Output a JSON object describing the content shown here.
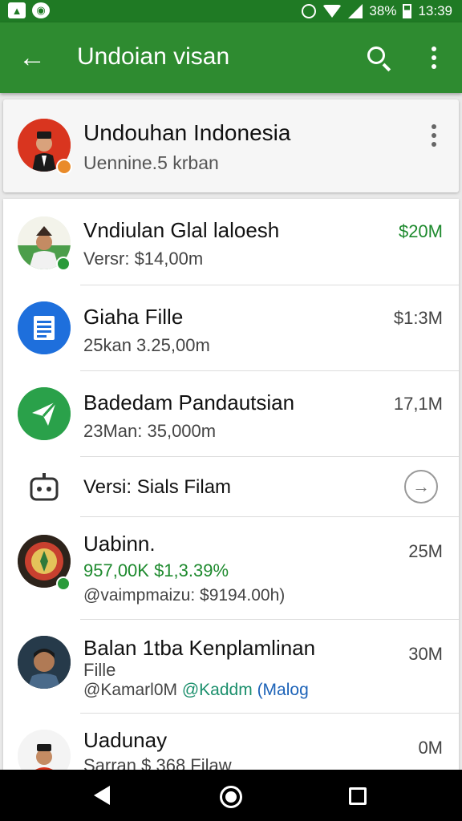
{
  "status_bar": {
    "battery": "38%",
    "time": "13:39",
    "left_icons": [
      "app-notification-icon",
      "whatsapp-icon"
    ],
    "right_icons": [
      "alarm-icon",
      "wifi-icon",
      "signal-icon",
      "battery-icon"
    ]
  },
  "app_bar": {
    "title": "Undoian visan",
    "icons": [
      "back-arrow-icon",
      "search-icon",
      "more-vert-icon"
    ],
    "color": "#2e8b30"
  },
  "header_card": {
    "name": "Undouhan Indonesia",
    "subtitle": "Uennine.5 krban"
  },
  "list": [
    {
      "title": "Vndiulan Glal laloesh",
      "subtitle": "Versr: $14,00m",
      "value": "$20M",
      "value_color": "#1e8a2e",
      "icon": "person-avatar"
    },
    {
      "title": "Giaha Fille",
      "subtitle": "25kan 3.25,00m",
      "value": "$1:3M",
      "icon": "document-icon"
    },
    {
      "title": "Badedam Pandautsian",
      "subtitle": "23Man: 35,000m",
      "value": "17,1M",
      "icon": "send-icon"
    },
    {
      "title": "Versi: Sials Filam",
      "icon": "robot-icon",
      "action_icon": "arrow-right-circle-icon"
    },
    {
      "title": "Uabinn.",
      "subtitle": "957,00K $1,3.39%",
      "line3": "@vaimpmaizu: $9194.00h)",
      "value": "25M",
      "icon": "emblem-avatar"
    },
    {
      "title": "Balan 1tba Kenplamlinan",
      "subtitle": "Fille",
      "line3_a": "@Kamarl0M",
      "line3_b": "@Kaddm",
      "line3_c": "(Malog",
      "value": "30M",
      "icon": "person-avatar"
    },
    {
      "title": "Uadunay",
      "subtitle": "Sarran $ 368 Filaw",
      "value": "0M",
      "icon": "person-avatar"
    }
  ],
  "nav_bar": {
    "icons": [
      "nav-back-icon",
      "nav-home-icon",
      "nav-recents-icon"
    ]
  }
}
